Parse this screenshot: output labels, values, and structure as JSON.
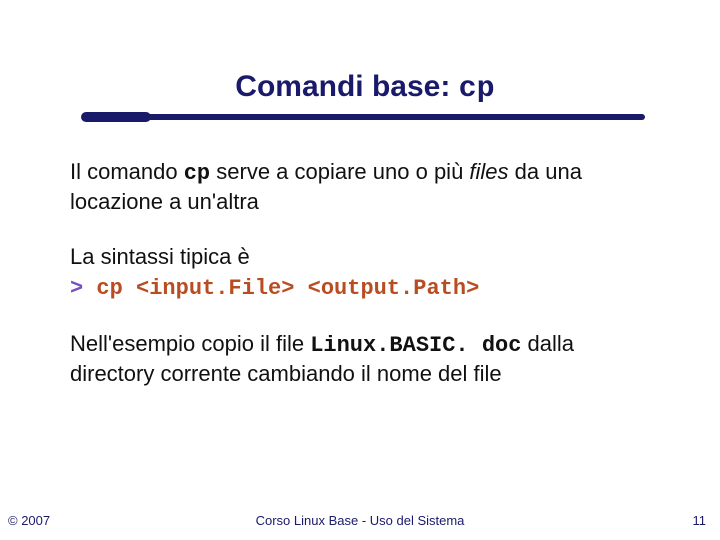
{
  "title": {
    "prefix": "Comandi base: ",
    "cmd": "cp"
  },
  "para1": {
    "t1": "Il comando ",
    "cmd": "cp",
    "t2": " serve a copiare uno o più ",
    "files": "files",
    "t3": " da una locazione a un'altra"
  },
  "para2": {
    "intro": "La sintassi tipica è",
    "prompt": "> ",
    "code": "cp <input.File> <output.Path>"
  },
  "para3": {
    "t1": "Nell'esempio copio il file ",
    "code": "Linux.BASIC. doc",
    "t2": " dalla directory  corrente cambiando il nome del file"
  },
  "footer": {
    "copyright": "© 2007",
    "center": "Corso Linux Base - Uso del Sistema",
    "page": "11"
  }
}
